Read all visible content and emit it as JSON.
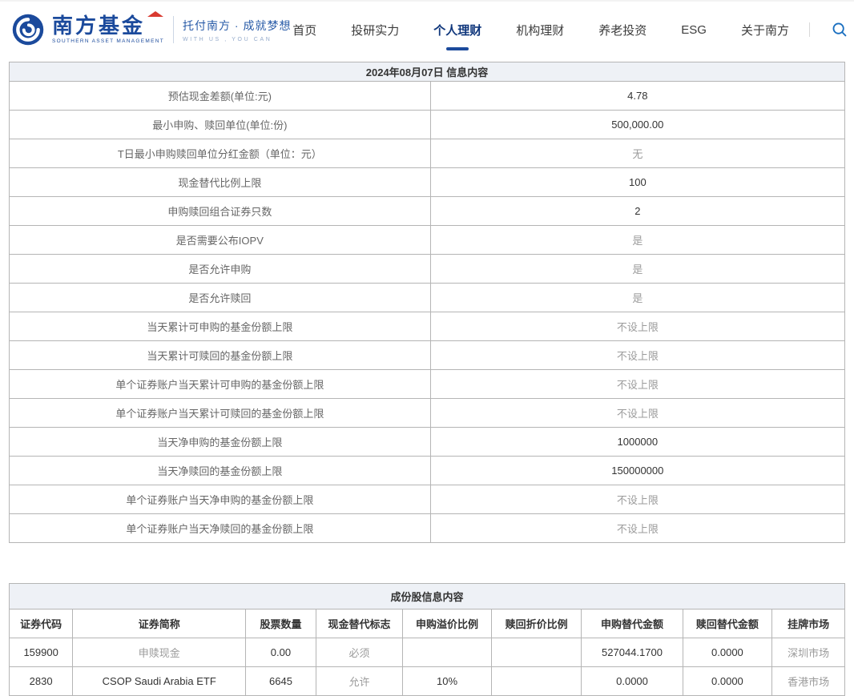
{
  "brand": {
    "logo_cn": "南方基金",
    "logo_en": "SOUTHERN ASSET MANAGEMENT",
    "tagline_cn": "托付南方 · 成就梦想",
    "tagline_en": "WITH US , YOU CAN"
  },
  "nav": {
    "items": [
      {
        "label": "首页",
        "active": false
      },
      {
        "label": "投研实力",
        "active": false
      },
      {
        "label": "个人理财",
        "active": true
      },
      {
        "label": "机构理财",
        "active": false
      },
      {
        "label": "养老投资",
        "active": false
      },
      {
        "label": "ESG",
        "active": false
      },
      {
        "label": "关于南方",
        "active": false
      }
    ],
    "search_icon": "search-icon"
  },
  "colors": {
    "brand_blue": "#1b4a9c",
    "accent_red": "#d93a30",
    "table_header_bg": "#eef1f6",
    "table_border": "#b5b5b5",
    "muted_text": "#9b9b9b"
  },
  "info_table": {
    "title": "2024年08月07日 信息内容",
    "rows": [
      {
        "label": "预估现金差额(单位:元)",
        "value": "4.78",
        "muted": false
      },
      {
        "label": "最小申购、赎回单位(单位:份)",
        "value": "500,000.00",
        "muted": false
      },
      {
        "label": "T日最小申购赎回单位分红金额（单位：元）",
        "value": "无",
        "muted": true
      },
      {
        "label": "现金替代比例上限",
        "value": "100",
        "muted": false
      },
      {
        "label": "申购赎回组合证券只数",
        "value": "2",
        "muted": false
      },
      {
        "label": "是否需要公布IOPV",
        "value": "是",
        "muted": true
      },
      {
        "label": "是否允许申购",
        "value": "是",
        "muted": true
      },
      {
        "label": "是否允许赎回",
        "value": "是",
        "muted": true
      },
      {
        "label": "当天累计可申购的基金份额上限",
        "value": "不设上限",
        "muted": true
      },
      {
        "label": "当天累计可赎回的基金份额上限",
        "value": "不设上限",
        "muted": true
      },
      {
        "label": "单个证券账户当天累计可申购的基金份额上限",
        "value": "不设上限",
        "muted": true
      },
      {
        "label": "单个证券账户当天累计可赎回的基金份额上限",
        "value": "不设上限",
        "muted": true
      },
      {
        "label": "当天净申购的基金份额上限",
        "value": "1000000",
        "muted": false
      },
      {
        "label": "当天净赎回的基金份额上限",
        "value": "150000000",
        "muted": false
      },
      {
        "label": "单个证券账户当天净申购的基金份额上限",
        "value": "不设上限",
        "muted": true
      },
      {
        "label": "单个证券账户当天净赎回的基金份额上限",
        "value": "不设上限",
        "muted": true
      }
    ]
  },
  "stock_table": {
    "title": "成份股信息内容",
    "headers": [
      "证券代码",
      "证券简称",
      "股票数量",
      "现金替代标志",
      "申购溢价比例",
      "赎回折价比例",
      "申购替代金额",
      "赎回替代金额",
      "挂牌市场"
    ],
    "rows": [
      {
        "cells": [
          "159900",
          "申赎现金",
          "0.00",
          "必须",
          "",
          "",
          "527044.1700",
          "0.0000",
          "深圳市场"
        ],
        "muted": [
          false,
          true,
          false,
          true,
          false,
          false,
          false,
          false,
          true
        ]
      },
      {
        "cells": [
          "2830",
          "CSOP Saudi Arabia ETF",
          "6645",
          "允许",
          "10%",
          "",
          "0.0000",
          "0.0000",
          "香港市场"
        ],
        "muted": [
          false,
          false,
          false,
          true,
          false,
          false,
          false,
          false,
          true
        ]
      }
    ]
  }
}
